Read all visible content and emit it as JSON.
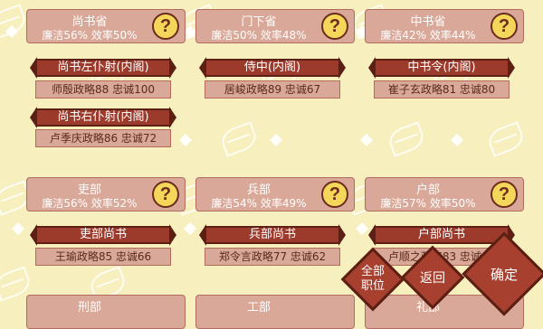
{
  "departments": [
    {
      "title": "尚书省",
      "stats": "廉洁56% 效率50%"
    },
    {
      "title": "门下省",
      "stats": "廉洁50% 效率48%"
    },
    {
      "title": "中书省",
      "stats": "廉洁42% 效率44%"
    },
    {
      "title": "吏部",
      "stats": "廉洁56% 效率52%"
    },
    {
      "title": "兵部",
      "stats": "廉洁54% 效率49%"
    },
    {
      "title": "户部",
      "stats": "廉洁57% 效率50%"
    },
    {
      "title": "刑部",
      "stats": ""
    },
    {
      "title": "工部",
      "stats": ""
    },
    {
      "title": "礼部",
      "stats": ""
    }
  ],
  "help_symbol": "?",
  "posts": [
    {
      "title": "尚书左仆射(内阁)",
      "official": "师殷政略88 忠诚100"
    },
    {
      "title": "侍中(内阁)",
      "official": "居峻政略89 忠诚67"
    },
    {
      "title": "中书令(内阁)",
      "official": "崔子玄政略81 忠诚80"
    },
    {
      "title": "尚书右仆射(内阁)",
      "official": "卢季庆政略86 忠诚72"
    },
    {
      "title": "吏部尚书",
      "official": "王瑜政略85 忠诚66"
    },
    {
      "title": "兵部尚书",
      "official": "郑令言政略77 忠诚62"
    },
    {
      "title": "户部尚书",
      "official": "卢顺之政略83 忠诚67"
    }
  ],
  "buttons": {
    "all_posts": "全部\n职位",
    "back": "返回",
    "confirm": "确定"
  }
}
